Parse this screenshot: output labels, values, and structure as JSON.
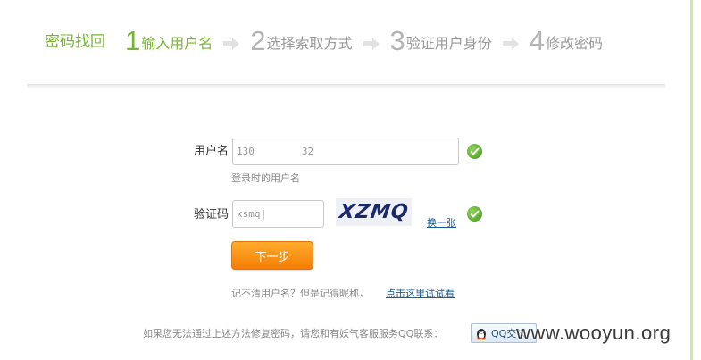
{
  "header": {
    "title": "密码找回",
    "steps": [
      {
        "num": "1",
        "label": "输入用户名",
        "active": true
      },
      {
        "num": "2",
        "label": "选择索取方式",
        "active": false
      },
      {
        "num": "3",
        "label": "验证用户身份",
        "active": false
      },
      {
        "num": "4",
        "label": "修改密码",
        "active": false
      }
    ]
  },
  "form": {
    "username_label": "用户名",
    "username_value": "130        32",
    "username_hint": "登录时的用户名",
    "captcha_label": "验证码",
    "captcha_value": "xsmq",
    "captcha_image_text": "XZMQ",
    "refresh_captcha": "换一张",
    "next_button": "下一步",
    "forgot_text": "记不清用户名？但是记得昵称，",
    "forgot_link": "点击这里试试看"
  },
  "footer": {
    "text": "如果您无法通过上述方法修复密码，请您和有妖气客服服务QQ联系：",
    "qq_button": "QQ交谈"
  },
  "watermark": "www.wooyun.org",
  "colors": {
    "accent_green": "#78b436",
    "inactive_step": "#b3b3b3",
    "button_orange": "#f57d05",
    "link_blue": "#1d5a8e"
  }
}
